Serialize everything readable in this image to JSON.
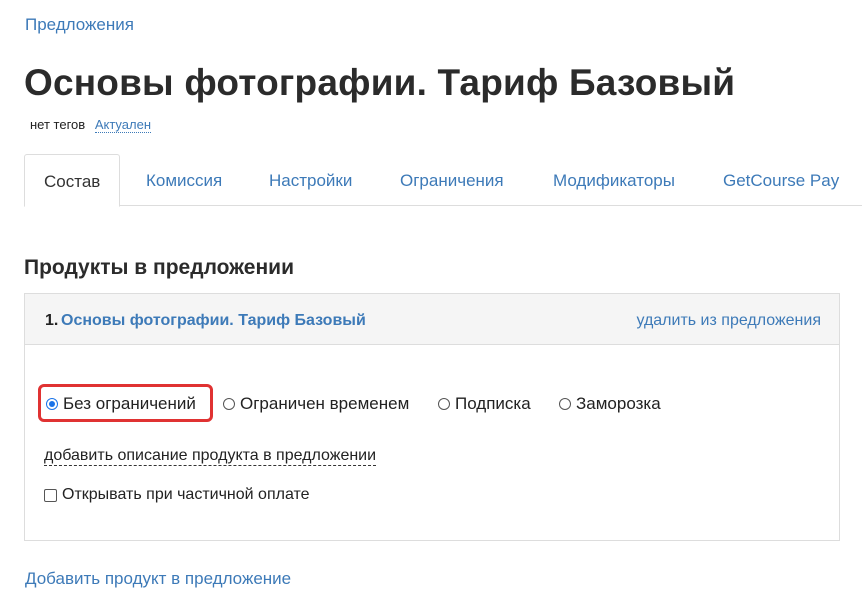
{
  "breadcrumb": {
    "label": "Предложения"
  },
  "page": {
    "title": "Основы фотографии. Тариф Базовый"
  },
  "meta": {
    "tags": "нет тегов",
    "status": "Актуален"
  },
  "tabs": [
    {
      "label": "Состав",
      "active": true
    },
    {
      "label": "Комиссия"
    },
    {
      "label": "Настройки"
    },
    {
      "label": "Ограничения"
    },
    {
      "label": "Модификаторы"
    },
    {
      "label": "GetCourse Pay"
    }
  ],
  "section": {
    "title": "Продукты в предложении"
  },
  "product": {
    "number": "1.",
    "name": "Основы фотографии. Тариф Базовый",
    "remove_label": "удалить из предложения",
    "access_options": [
      {
        "label": "Без ограничений",
        "checked": true
      },
      {
        "label": "Ограничен временем",
        "checked": false
      },
      {
        "label": "Подписка",
        "checked": false
      },
      {
        "label": "Заморозка",
        "checked": false
      }
    ],
    "add_description_label": "добавить описание продукта в предложении",
    "partial_payment_label": "Открывать при частичной оплате",
    "partial_payment_checked": false
  },
  "footer": {
    "add_product_label": "Добавить продукт в предложение"
  },
  "colors": {
    "link": "#3d7ab8",
    "highlight": "#e03232",
    "radio_checked": "#1a73e8"
  }
}
